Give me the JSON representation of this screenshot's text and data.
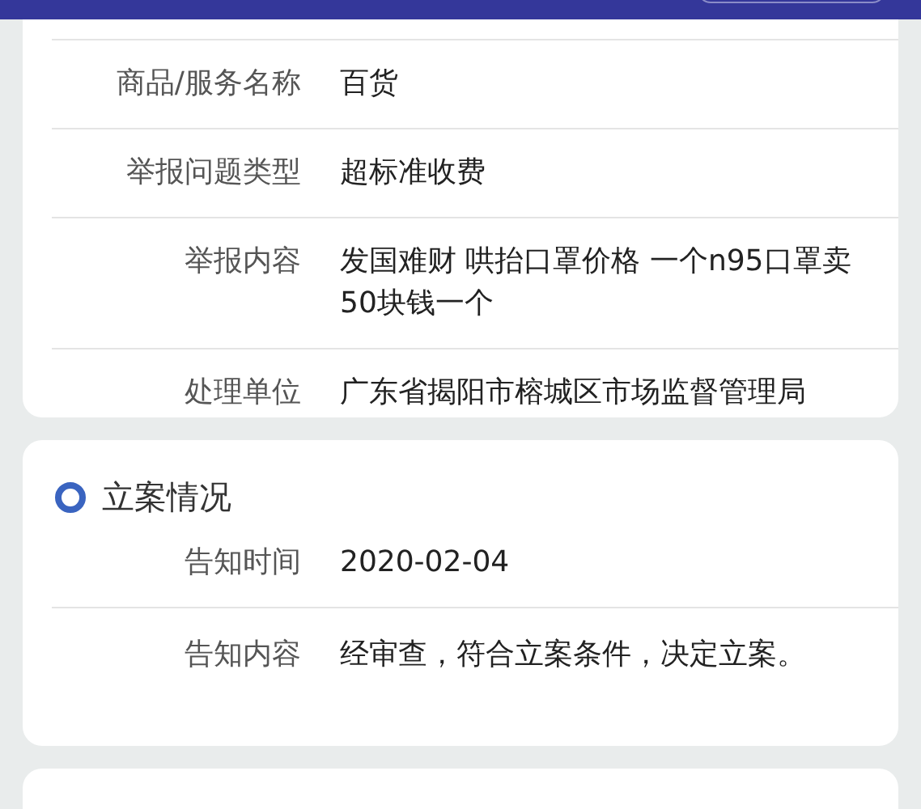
{
  "report": {
    "rows": [
      {
        "label": "商品/服务名称",
        "value": "百货"
      },
      {
        "label": "举报问题类型",
        "value": "超标准收费"
      },
      {
        "label": "举报内容",
        "value": "发国难财 哄抬口罩价格 一个n95口罩卖50块钱一个"
      },
      {
        "label": "处理单位",
        "value": "广东省揭阳市榕城区市场监督管理局"
      }
    ]
  },
  "filing": {
    "title": "立案情况",
    "rows": [
      {
        "label": "告知时间",
        "value": "2020-02-04"
      },
      {
        "label": "告知内容",
        "value": "经审查，符合立案条件，决定立案。"
      }
    ]
  }
}
